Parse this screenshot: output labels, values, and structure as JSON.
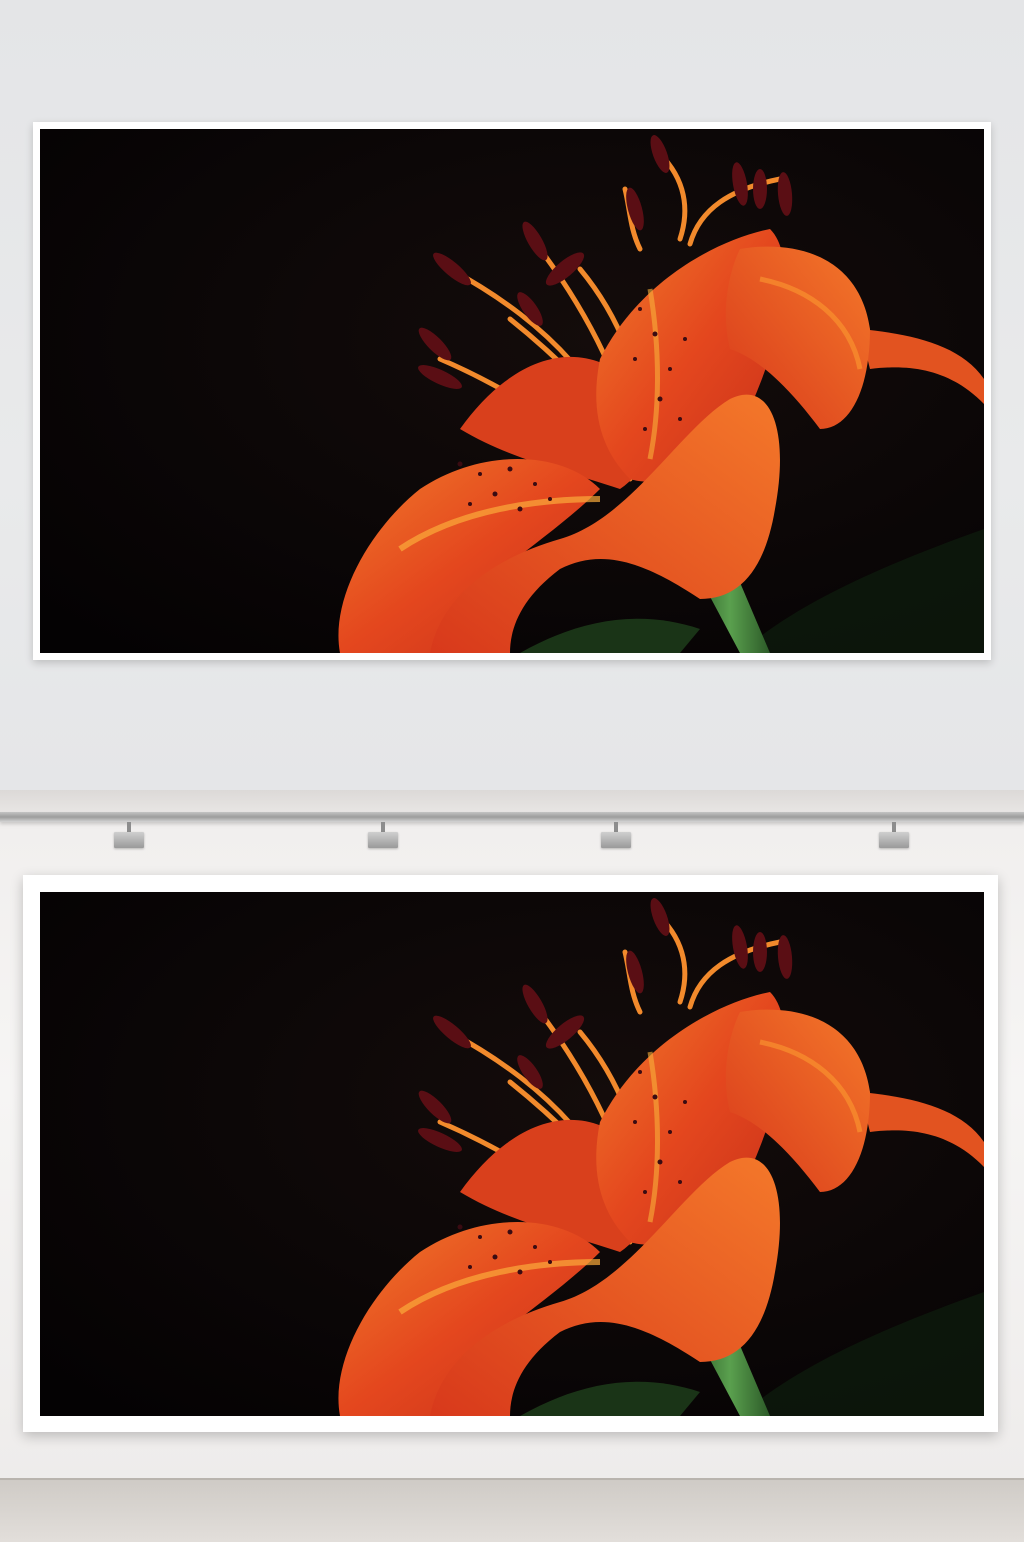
{
  "scene": {
    "description_icons": [
      "lily-photo",
      "spotlight-icon"
    ],
    "colors": {
      "wall": "#e6e6e8",
      "photo_background": "#070405",
      "petal": "#e8461f",
      "petal_highlight": "#f98a2a",
      "anther": "#5a0e14",
      "stem": "#3f7d3a",
      "frame": "#ffffff"
    }
  }
}
